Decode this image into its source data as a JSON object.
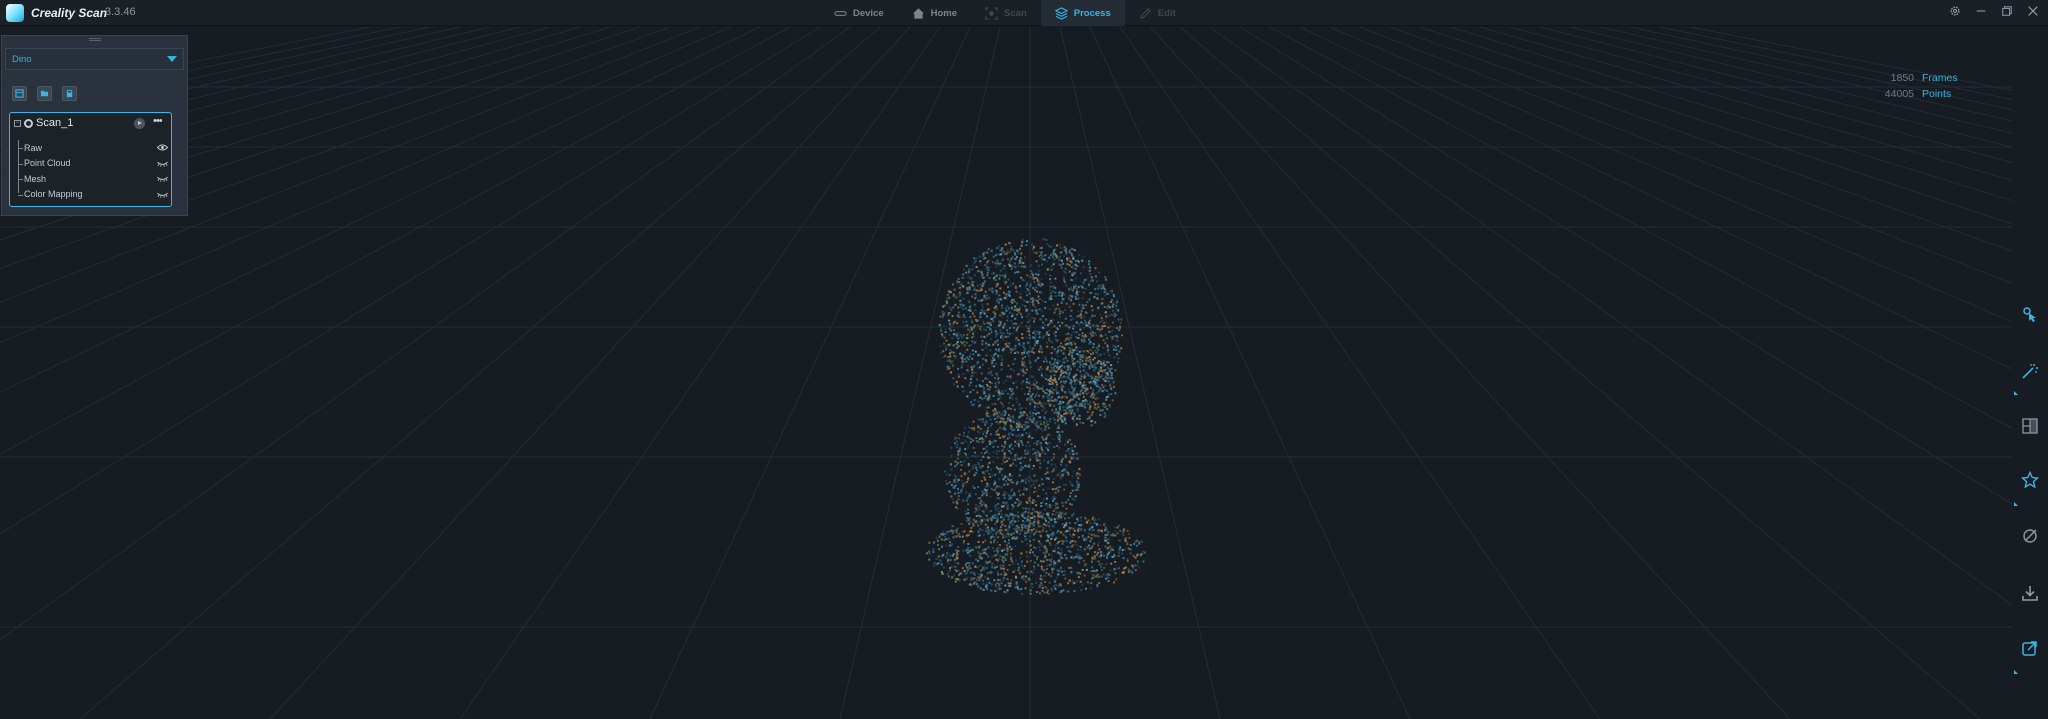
{
  "app": {
    "name": "Creality Scan",
    "version": "3.3.46"
  },
  "nav": {
    "tabs": [
      {
        "label": "Device",
        "icon": "device-icon",
        "state": "normal"
      },
      {
        "label": "Home",
        "icon": "home-icon",
        "state": "normal"
      },
      {
        "label": "Scan",
        "icon": "scan-icon",
        "state": "disabled"
      },
      {
        "label": "Process",
        "icon": "process-layers-icon",
        "state": "active"
      },
      {
        "label": "Edit",
        "icon": "edit-icon",
        "state": "disabled"
      }
    ]
  },
  "window_controls": [
    "settings-icon",
    "minimize-icon",
    "restore-icon",
    "close-icon"
  ],
  "stats": {
    "frames_value": "1850",
    "frames_label": "Frames",
    "points_value": "44005",
    "points_label": "Points"
  },
  "project_panel": {
    "project_name": "Dino",
    "tools": [
      "new-project-icon",
      "open-folder-icon",
      "save-icon"
    ],
    "scan": {
      "name": "Scan_1",
      "items": [
        {
          "label": "Raw",
          "visible": true
        },
        {
          "label": "Point Cloud",
          "visible": false
        },
        {
          "label": "Mesh",
          "visible": false
        },
        {
          "label": "Color Mapping",
          "visible": false
        }
      ]
    }
  },
  "right_toolbar": [
    "select-point-icon",
    "point-cloud-process-icon",
    "mesh-icon",
    "texture-icon",
    "measure-icon",
    "export-icon",
    "share-icon"
  ],
  "colors": {
    "accent": "#3ab4e6",
    "background": "#171c22",
    "panel": "#2a333d"
  }
}
